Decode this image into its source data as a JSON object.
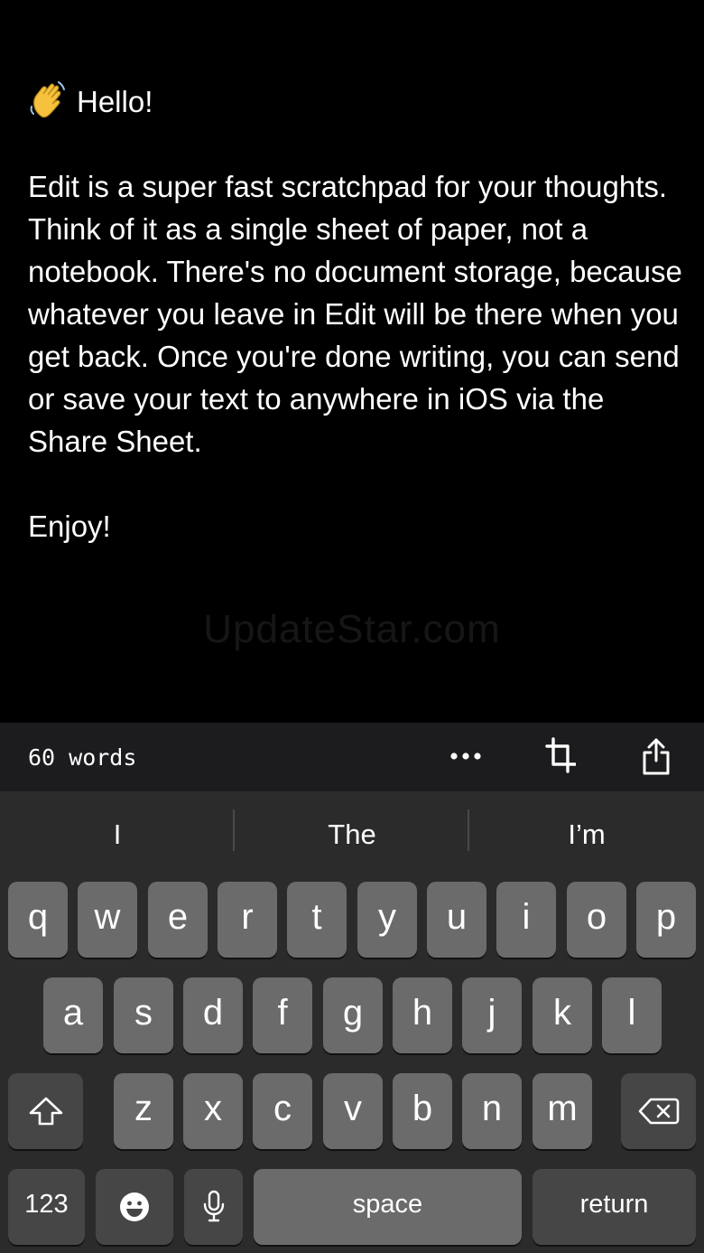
{
  "editor": {
    "greeting": "Hello!",
    "greeting_icon": "waving-hand-icon",
    "paragraph": "Edit is a super fast scratchpad for your thoughts. Think of it as a single sheet of paper, not a notebook. There's no document storage, because whatever you leave in Edit will be there when you get back. Once you're done writing, you can send or save your text to anywhere in iOS via the Share Sheet.",
    "closing": "Enjoy!",
    "watermark": "UpdateStar.com"
  },
  "toolbar": {
    "word_count": "60 words",
    "icons": [
      "more-icon",
      "crop-icon",
      "share-icon"
    ]
  },
  "keyboard": {
    "suggestions": [
      "I",
      "The",
      "I’m"
    ],
    "row1": [
      "q",
      "w",
      "e",
      "r",
      "t",
      "y",
      "u",
      "i",
      "o",
      "p"
    ],
    "row2": [
      "a",
      "s",
      "d",
      "f",
      "g",
      "h",
      "j",
      "k",
      "l"
    ],
    "row3": [
      "z",
      "x",
      "c",
      "v",
      "b",
      "n",
      "m"
    ],
    "numbers_label": "123",
    "space_label": "space",
    "return_label": "return",
    "colors": {
      "key": "#6b6b6b",
      "function_key": "#464646",
      "background": "#2b2b2b"
    }
  }
}
